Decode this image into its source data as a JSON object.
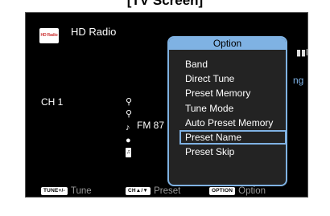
{
  "caption": "[TV Screen]",
  "source": {
    "logo_text": "HD Radio",
    "name": "HD Radio"
  },
  "channel": "CH 1",
  "frequency": "FM 87",
  "status": {
    "partial_text": "ng"
  },
  "icons": [
    "signal-icon",
    "hd-signal-icon",
    "station-icon",
    "music-note-icon",
    "artist-icon",
    "album-icon",
    "signal-bars-icon"
  ],
  "footer": [
    {
      "key": "TUNE+/-",
      "label": "Tune"
    },
    {
      "key": "CH▲/▼",
      "label": "Preset"
    },
    {
      "key": "OPTION",
      "label": "Option"
    }
  ],
  "option_menu": {
    "title": "Option",
    "items": [
      "Band",
      "Direct Tune",
      "Preset Memory",
      "Tune Mode",
      "Auto Preset Memory",
      "Preset Name",
      "Preset Skip"
    ],
    "selected": "Preset Name"
  },
  "colors": {
    "accent": "#7fb2e3",
    "background": "#000000",
    "panel": "#232323"
  }
}
